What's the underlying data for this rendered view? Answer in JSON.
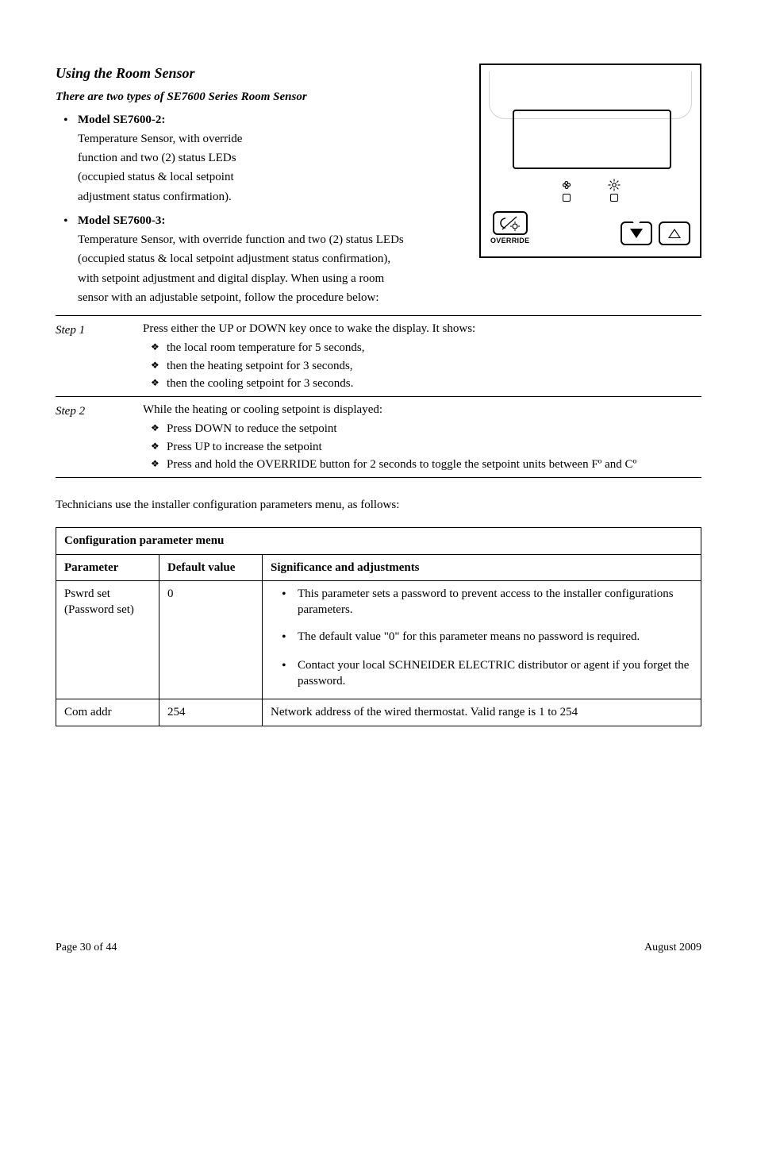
{
  "section_title": "Using the Room Sensor",
  "intro": "There are two types of SE7600 Series Room Sensor",
  "sensor_types": [
    {
      "bold": "Model SE7600-2:",
      "lines": [
        "Temperature Sensor, with override",
        "function and two (2) status LEDs",
        "(occupied status & local setpoint",
        "adjustment status confirmation)."
      ]
    },
    {
      "bold": "Model SE7600-3:",
      "lines": [
        "Temperature Sensor, with override function and two (2) status LEDs",
        "(occupied status & local setpoint adjustment status confirmation),",
        "with setpoint adjustment and digital display.  When using a room",
        "sensor with an adjustable setpoint, follow the procedure below:"
      ]
    }
  ],
  "device": {
    "override_label": "OVERRIDE"
  },
  "steps": [
    {
      "num": "Step 1",
      "lead": "Press either the UP or DOWN key once to wake the display.  It shows:",
      "items": [
        "the local room temperature for 5 seconds,",
        "then the heating setpoint for 3 seconds,",
        "then the cooling setpoint for 3 seconds."
      ]
    },
    {
      "num": "Step 2",
      "lead": "While the heating or cooling setpoint is displayed:",
      "items": [
        "Press DOWN to reduce the setpoint",
        "Press UP to increase the setpoint",
        "Press and hold the OVERRIDE button for 2 seconds to toggle the setpoint units between Fº and Cº"
      ]
    }
  ],
  "tech_heading": "Technicians use the installer configuration parameters menu, as follows:",
  "table": {
    "title": "Configuration parameter menu",
    "col1": "Parameter",
    "col2": "Default value",
    "col3": "Significance and adjustments",
    "rows": [
      {
        "param": "Pswrd set (Password set)",
        "default": "0",
        "sig_bullets": [
          "This parameter sets a password to prevent access to the installer configurations parameters.",
          "The default value \"0\" for this parameter means no password is required.",
          "Contact your local SCHNEIDER ELECTRIC distributor or agent if you forget the password."
        ]
      },
      {
        "param": "Com addr",
        "default": "254",
        "sig_text": "Network address of the wired thermostat. Valid range is 1 to 254"
      }
    ]
  },
  "footer_left": "Page 30 of 44",
  "footer_right": "August 2009"
}
